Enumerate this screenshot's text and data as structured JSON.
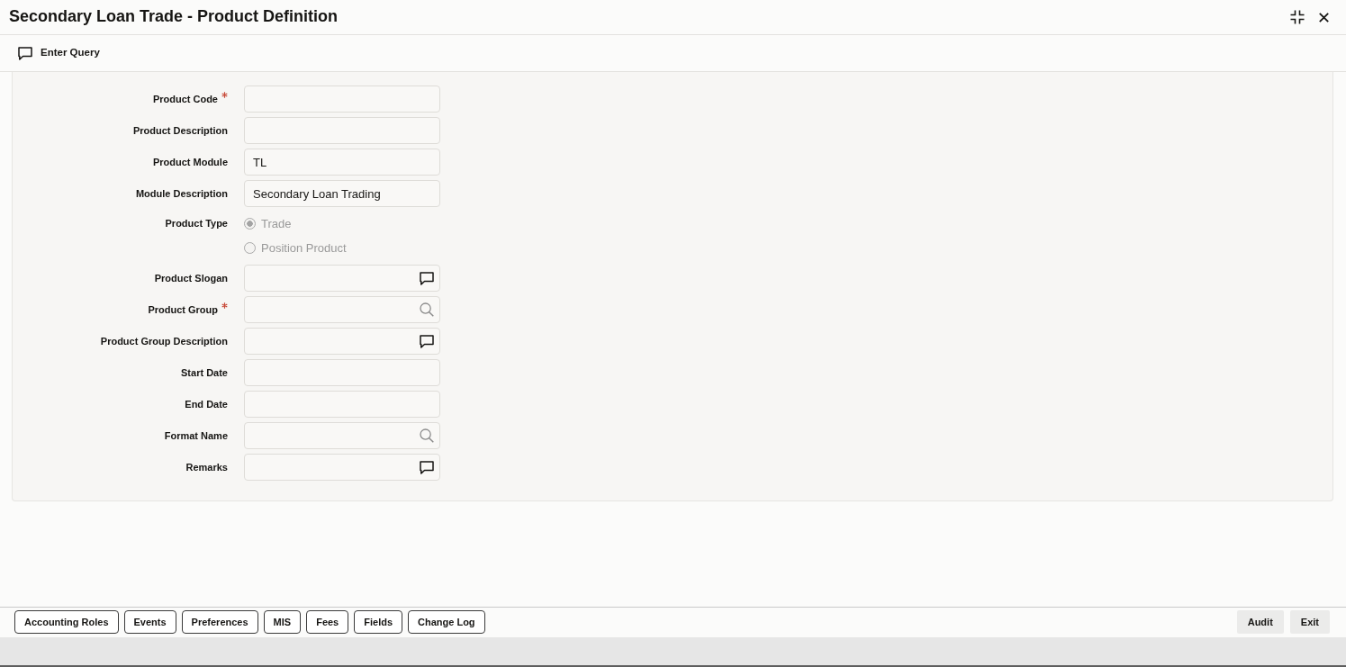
{
  "window": {
    "title": "Secondary Loan Trade - Product Definition"
  },
  "toolbar": [
    {
      "label": "Enter Query"
    }
  ],
  "form": {
    "fields": [
      {
        "label": "Product Code",
        "required": true,
        "kind": "text"
      },
      {
        "label": "Product Description",
        "required": false,
        "kind": "text"
      },
      {
        "label": "Product Module",
        "required": false,
        "kind": "text",
        "value": "TL"
      },
      {
        "label": "Module Description",
        "required": false,
        "kind": "text",
        "value": "Secondary Loan Trading"
      },
      {
        "label": "Product Type",
        "required": false,
        "kind": "radio",
        "options": [
          {
            "label": "Trade",
            "selected": true,
            "disabled": true
          },
          {
            "label": "Position Product",
            "selected": false,
            "disabled": true
          }
        ]
      },
      {
        "label": "Product Slogan",
        "required": false,
        "kind": "popup"
      },
      {
        "label": "Product Group",
        "required": true,
        "kind": "lookup"
      },
      {
        "label": "Product Group Description",
        "required": false,
        "kind": "popup"
      },
      {
        "label": "Start Date",
        "required": false,
        "kind": "text"
      },
      {
        "label": "End Date",
        "required": false,
        "kind": "text"
      },
      {
        "label": "Format Name",
        "required": false,
        "kind": "lookup"
      },
      {
        "label": "Remarks",
        "required": false,
        "kind": "popup"
      }
    ]
  },
  "footer": {
    "left_buttons": [
      "Accounting Roles",
      "Events",
      "Preferences",
      "MIS",
      "Fees",
      "Fields",
      "Change Log"
    ],
    "right_buttons": [
      "Audit",
      "Exit"
    ]
  }
}
